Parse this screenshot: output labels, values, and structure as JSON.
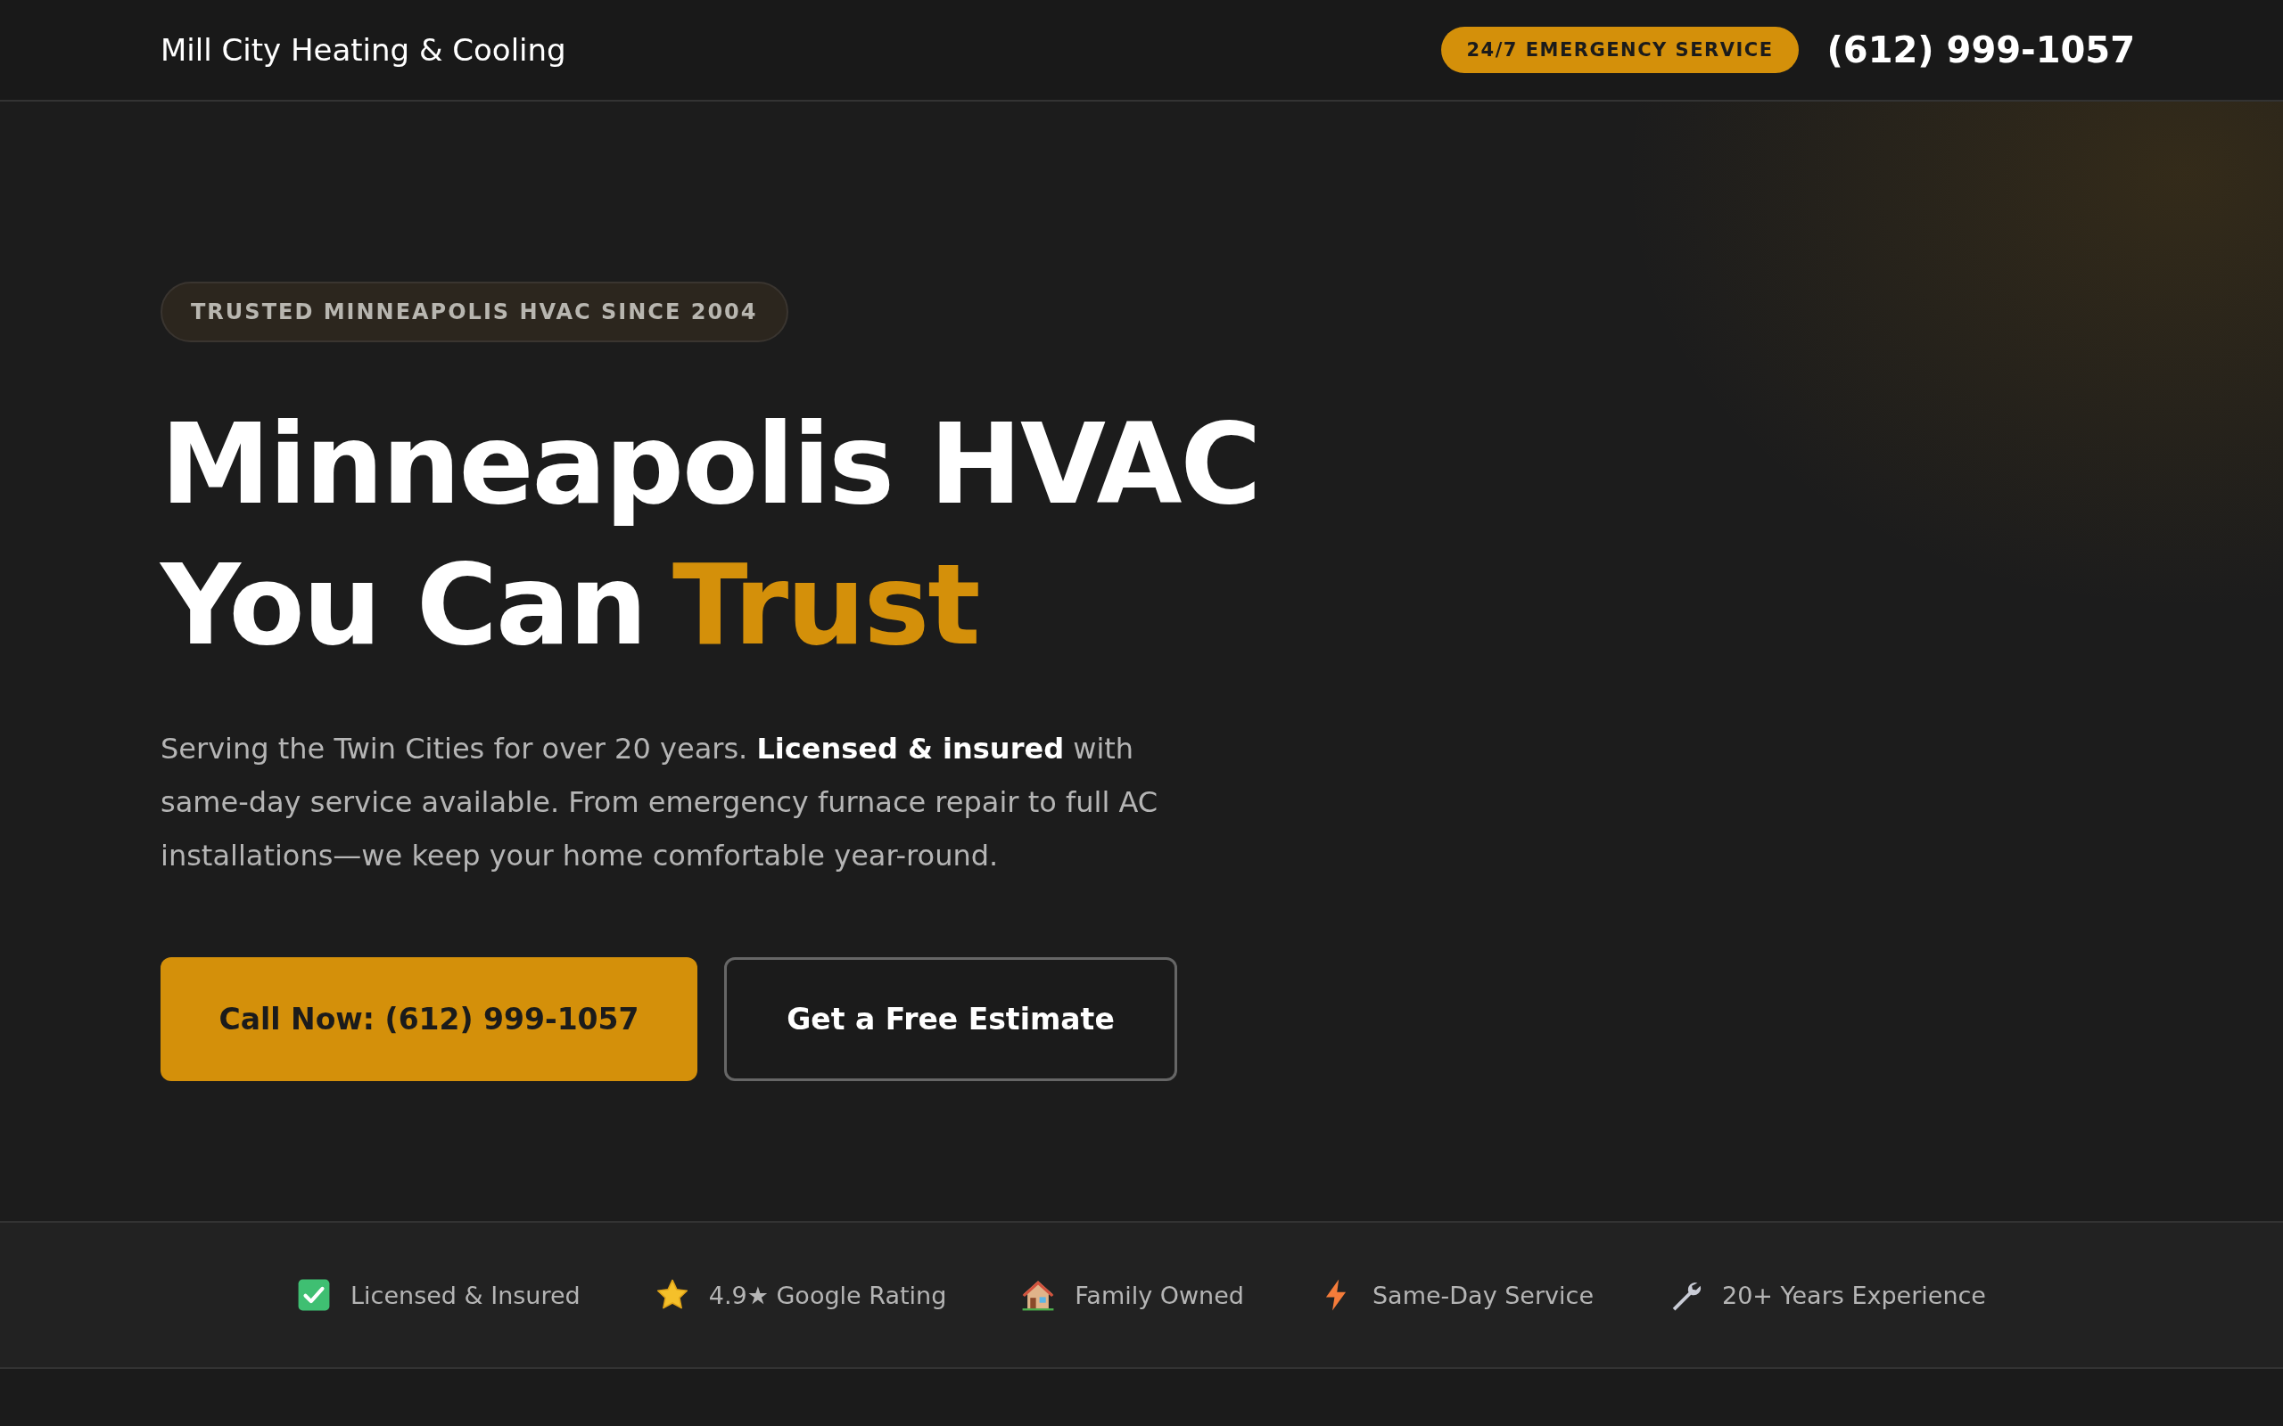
{
  "header": {
    "logo": "Mill City Heating & Cooling",
    "emergency_badge": "24/7 EMERGENCY SERVICE",
    "phone": "(612) 999-1057"
  },
  "hero": {
    "badge": "TRUSTED MINNEAPOLIS HVAC SINCE 2004",
    "headline_line_1": "Minneapolis HVAC",
    "headline_line_2": "You Can",
    "headline_accent": "Trust",
    "description": "Serving the Twin Cities for over 20 years. **Licensed & insured** with same-day service available. From emergency furnace repair to full AC installations—we keep your home comfortable year-round.",
    "buttons": [
      {
        "kind": "primary",
        "label": "Call Now: (612) 999-1057"
      },
      {
        "kind": "outline",
        "label": "Get a Free Estimate"
      }
    ]
  },
  "trust_bar": [
    {
      "kind": "check",
      "label": "Licensed & Insured"
    },
    {
      "kind": "star",
      "label": "4.9★ Google Rating"
    },
    {
      "kind": "house",
      "label": "Family Owned"
    },
    {
      "kind": "bolt",
      "label": "Same-Day Service"
    },
    {
      "kind": "wrench",
      "label": "20+ Years Experience"
    }
  ]
}
